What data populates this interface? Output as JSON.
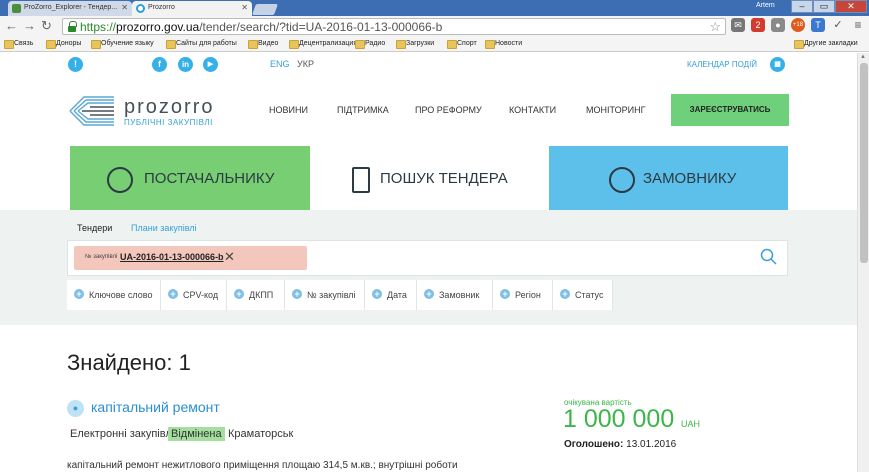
{
  "browser": {
    "tabs": [
      {
        "title": "ProZorro_Explorer - Тендер..."
      },
      {
        "title": "Prozorro"
      }
    ],
    "user": "Artem",
    "window_controls": [
      "–",
      "▭",
      "✕"
    ],
    "url": {
      "scheme": "https://",
      "host": "prozorro.gov.ua",
      "path": "/tender/search/?tid=UA-2016-01-13-000066-b"
    },
    "bookmarks": [
      "Связь",
      "Доноры",
      "Обучение языку",
      "Сайты для работы",
      "Видео",
      "Децентрализация",
      "Радио",
      "Загрузки",
      "Спорт",
      "Новости"
    ],
    "other_bookmarks": "Другие закладки",
    "extension_badge": "2",
    "extension_badge_2": "+18"
  },
  "topbar": {
    "lang_en": "ENG",
    "lang_uk": "УКР",
    "calendar": "КАЛЕНДАР ПОДІЙ"
  },
  "header": {
    "logo_name": "prozorro",
    "logo_sub": "ПУБЛІЧНІ ЗАКУПІВЛІ",
    "menu": [
      "НОВИНИ",
      "ПІДТРИМКА",
      "ПРО РЕФОРМУ",
      "КОНТАКТИ",
      "МОНІТОРИНГ"
    ],
    "register": "ЗАРЕЄСТРУВАТИСЬ"
  },
  "big_tabs": [
    "ПОСТАЧАЛЬНИКУ",
    "ПОШУК ТЕНДЕРА",
    "ЗАМОВНИКУ"
  ],
  "colors": {
    "supplier_green": "#78cf73",
    "customer_blue": "#5cc0ea",
    "brand_blue": "#35a0d8",
    "amount_green": "#3db54a"
  },
  "search": {
    "subtabs": [
      "Тендери",
      "Плани закупівлі"
    ],
    "chip_label": "№ закупівлі",
    "chip_value": "UA-2016-01-13-000066-b",
    "filters": [
      "Ключове слово",
      "CPV-код",
      "ДКПП",
      "№ закупівлі",
      "Дата",
      "Замовник",
      "Регіон",
      "Статус"
    ]
  },
  "results": {
    "found": "Знайдено: 1",
    "tender": {
      "title": "капітальний ремонт",
      "type": "Електронні закупівлі",
      "status": "Відмінена",
      "city": "Краматорськ",
      "estimate_label": "очікувана вартість",
      "amount": "1 000 000",
      "currency": "UAH",
      "announced_label": "Оголошено:",
      "announced_date": "13.01.2016",
      "description": "капітальний ремонт нежитлового приміщення площаю 314,5 м.кв.; внутрішні роботи"
    }
  }
}
